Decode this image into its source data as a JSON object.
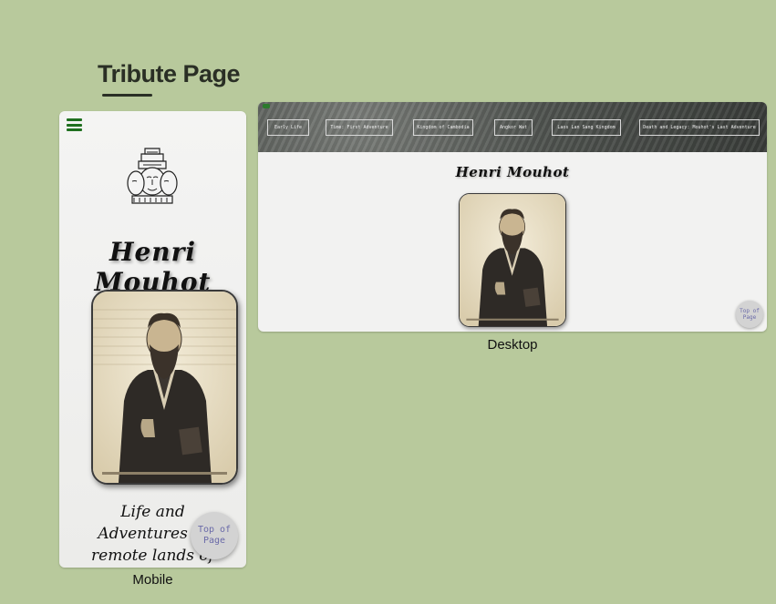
{
  "page": {
    "title": "Tribute Page"
  },
  "mobile": {
    "caption": "Mobile",
    "name": "Henri Mouhot",
    "tagline": [
      "Life and",
      "Adventures in",
      "remote lands of"
    ],
    "top_button": [
      "Top of",
      "Page"
    ]
  },
  "desktop": {
    "caption": "Desktop",
    "name": "Henri Mouhot",
    "nav": [
      "Early Life",
      "Time: First Adventure",
      "Kingdom of Cambodia",
      "Angkor Wat",
      "Laos Lan Sang Kingdom",
      "Death and Legacy: Mouhot's Last Adventure"
    ],
    "top_button": [
      "Top of",
      "Page"
    ]
  },
  "colors": {
    "background": "#b8c99c",
    "accent": "#1f6f1f",
    "button": "#d3d3d3"
  }
}
